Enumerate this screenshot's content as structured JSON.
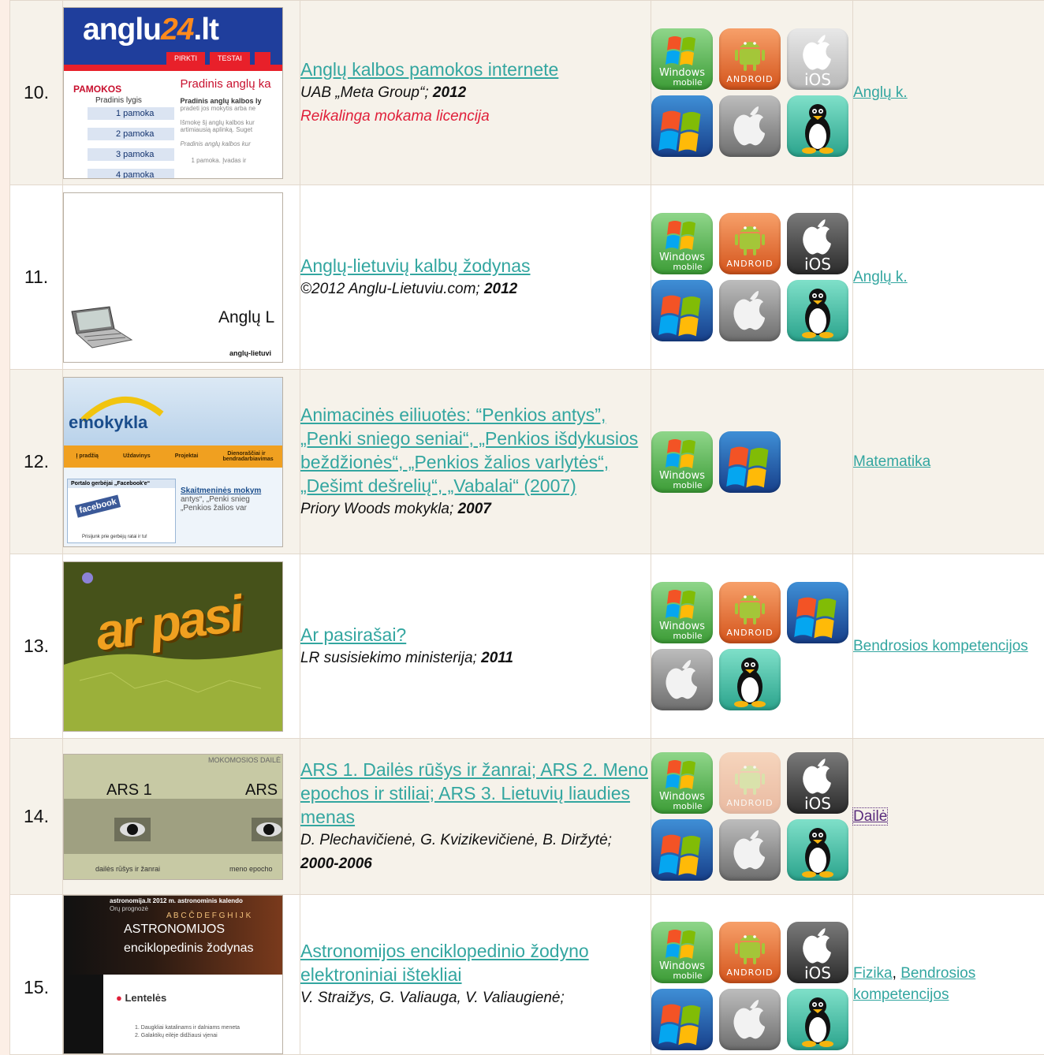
{
  "rows": [
    {
      "num": "10.",
      "title": "Anglų kalbos pamokos internete",
      "author": "UAB „Meta Group“;",
      "year": "2012",
      "warning": "Reikalinga mokama licencija",
      "subjects": [
        "Anglų k."
      ],
      "thumb": {
        "logo_main": "anglu",
        "logo_num": "24",
        "logo_tld": ".lt",
        "nav": [
          "PIRKTI",
          "TESTAI"
        ],
        "side_title": "PAMOKOS",
        "side_sub": "Pradinis lygis",
        "lessons": [
          "1 pamoka",
          "2 pamoka",
          "3 pamoka",
          "4 pamoka"
        ],
        "heading": "Pradinis anglų ka",
        "sub1": "Pradinis anglų kalbos ly",
        "sub2": "pradeti jos mokytis arba ne",
        "sub3": "Išmokę šį anglų kalbos kur",
        "sub4": "artimiausią aplinką. Suget",
        "sub5": "Pradinis anglų kalbos kur",
        "sub6": "1 pamoka. Įvadas ir"
      },
      "platforms": [
        "winmobile",
        "android",
        "ios-light",
        "windows",
        "mac",
        "linux"
      ]
    },
    {
      "num": "11.",
      "title": "Anglų-lietuvių kalbų žodynas",
      "author": "©2012 Anglu-Lietuviu.com;",
      "year": "2012",
      "subjects": [
        "Anglų k."
      ],
      "thumb": {
        "heading": "Anglų L",
        "caption": "anglų-lietuvi"
      },
      "platforms": [
        "winmobile",
        "android",
        "ios-dark",
        "windows",
        "mac",
        "linux"
      ]
    },
    {
      "num": "12.",
      "title": "Animacinės eiliuotės: “Penkios antys”, „Penki sniego seniai“, „Penkios išdykusios beždžionės“, „Penkios žalios varlytės“, „Dešimt dešrelių“, „Vabalai“ (2007)",
      "author": "Priory Woods mokykla;",
      "year": "2007",
      "subjects": [
        "Matematika"
      ],
      "thumb": {
        "logo": "emokykla",
        "nav": [
          "Į pradžią",
          "Uždavinys",
          "Projektai",
          "Dienoraščiai ir bendradarbiavimas"
        ],
        "fb_label": "Portalo gerbėjai „Facebook'e“",
        "fb_name": "facebook",
        "fb_foot": "Prisijunk prie gerbėjų ratai ir tu!",
        "sk_title": "Skaitmeninės mokym",
        "sk_text1": "antys“, „Penki snieg",
        "sk_text2": "„Penkios žalios var"
      },
      "platforms": [
        "winmobile",
        "windows"
      ]
    },
    {
      "num": "13.",
      "title": "Ar pasirašai?",
      "author": "LR susisiekimo ministerija;",
      "year": "2011",
      "subjects": [
        "Bendrosios kompetencijos"
      ],
      "thumb": {
        "graffiti": "ar pasi"
      },
      "platforms": [
        "winmobile",
        "android",
        "windows",
        "mac",
        "linux"
      ]
    },
    {
      "num": "14.",
      "title": "ARS 1. Dailės rūšys ir žanrai; ARS 2. Meno epochos ir stiliai; ARS 3. Lietuvių liaudies menas",
      "author": "D. Plechavičienė, G. Kvizikevičienė, B. Diržytė;",
      "year": "2000-2006",
      "subjects": [
        "Dailė"
      ],
      "thumb": {
        "header": "MOKOMOSIOS DAILĖ",
        "left": "ARS 1",
        "right": "ARS",
        "cap_left": "dailės rūšys ir žanrai",
        "cap_right": "meno epocho"
      },
      "platforms": [
        "winmobile",
        "android-faded",
        "ios-dark",
        "windows",
        "mac",
        "linux"
      ]
    },
    {
      "num": "15.",
      "title": "Astronomijos enciklopedinio žodyno elektroniniai ištekliai",
      "author": "V. Straižys, G. Valiauga, V. Valiaugienė;",
      "year": "",
      "subjects": [
        "Fizika",
        "Bendrosios kompetencijos"
      ],
      "thumb": {
        "top": "astronomija.lt   2012 m. astronominis kalendo",
        "topsub": "Orų prognozė",
        "alpha": "A B C Č D E F G H I J K",
        "t1": "ASTRONOMIJOS",
        "t2": "enciklopedinis žodynas",
        "lent": "Lentelės",
        "l1": "1. Daugkliai katalinams ir dalniams meneta",
        "l2": "2. Galaktikų eilėje didžiausi vjenai"
      },
      "platforms": [
        "winmobile",
        "android",
        "ios-dark",
        "windows",
        "mac",
        "linux"
      ]
    }
  ],
  "platform_labels": {
    "winmobile_top": "Windows",
    "winmobile_bottom": "mobile",
    "android": "ANDROID",
    "ios": "iOS"
  },
  "colors": {
    "link": "#33a6a0",
    "warning": "#e0203a",
    "page_bg": "#fcefe6"
  }
}
